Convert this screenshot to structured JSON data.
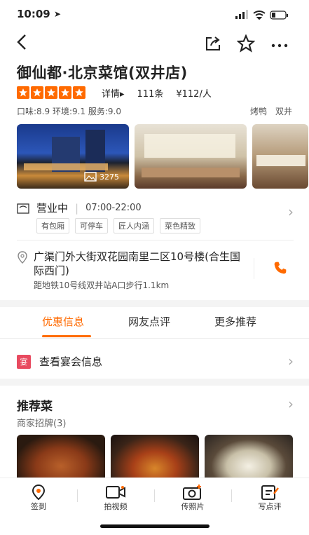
{
  "status": {
    "time": "10:09"
  },
  "restaurant": {
    "name": "御仙都·北京菜馆(双井店)",
    "rating_stars": 5,
    "detail_label": "详情▸",
    "review_count": "111条",
    "price": "¥112/人",
    "scores": "口味:8.9 环境:9.1 服务:9.0",
    "tags": [
      "烤鸭",
      "双井"
    ],
    "photo_count": "3275"
  },
  "hours": {
    "status": "营业中",
    "range": "07:00-22:00",
    "features": [
      "有包厢",
      "可停车",
      "匠人内涵",
      "菜色精致"
    ]
  },
  "address": {
    "line": "广渠门外大街双花园南里二区10号楼(合生国际西门)",
    "subway": "距地铁10号线双井站A口步行1.1km"
  },
  "tabs": [
    "优惠信息",
    "网友点评",
    "更多推荐"
  ],
  "banquet": {
    "badge": "宴",
    "label": "查看宴会信息"
  },
  "recommend": {
    "title": "推荐菜",
    "subtitle": "商家招牌(3)"
  },
  "bottom_bar": [
    {
      "label": "签到",
      "icon": "location-pin-icon"
    },
    {
      "label": "拍视频",
      "icon": "video-icon"
    },
    {
      "label": "传照片",
      "icon": "camera-plus-icon"
    },
    {
      "label": "写点评",
      "icon": "edit-icon"
    }
  ],
  "colors": {
    "accent": "#ff6a00",
    "badge": "#e84a5f"
  }
}
